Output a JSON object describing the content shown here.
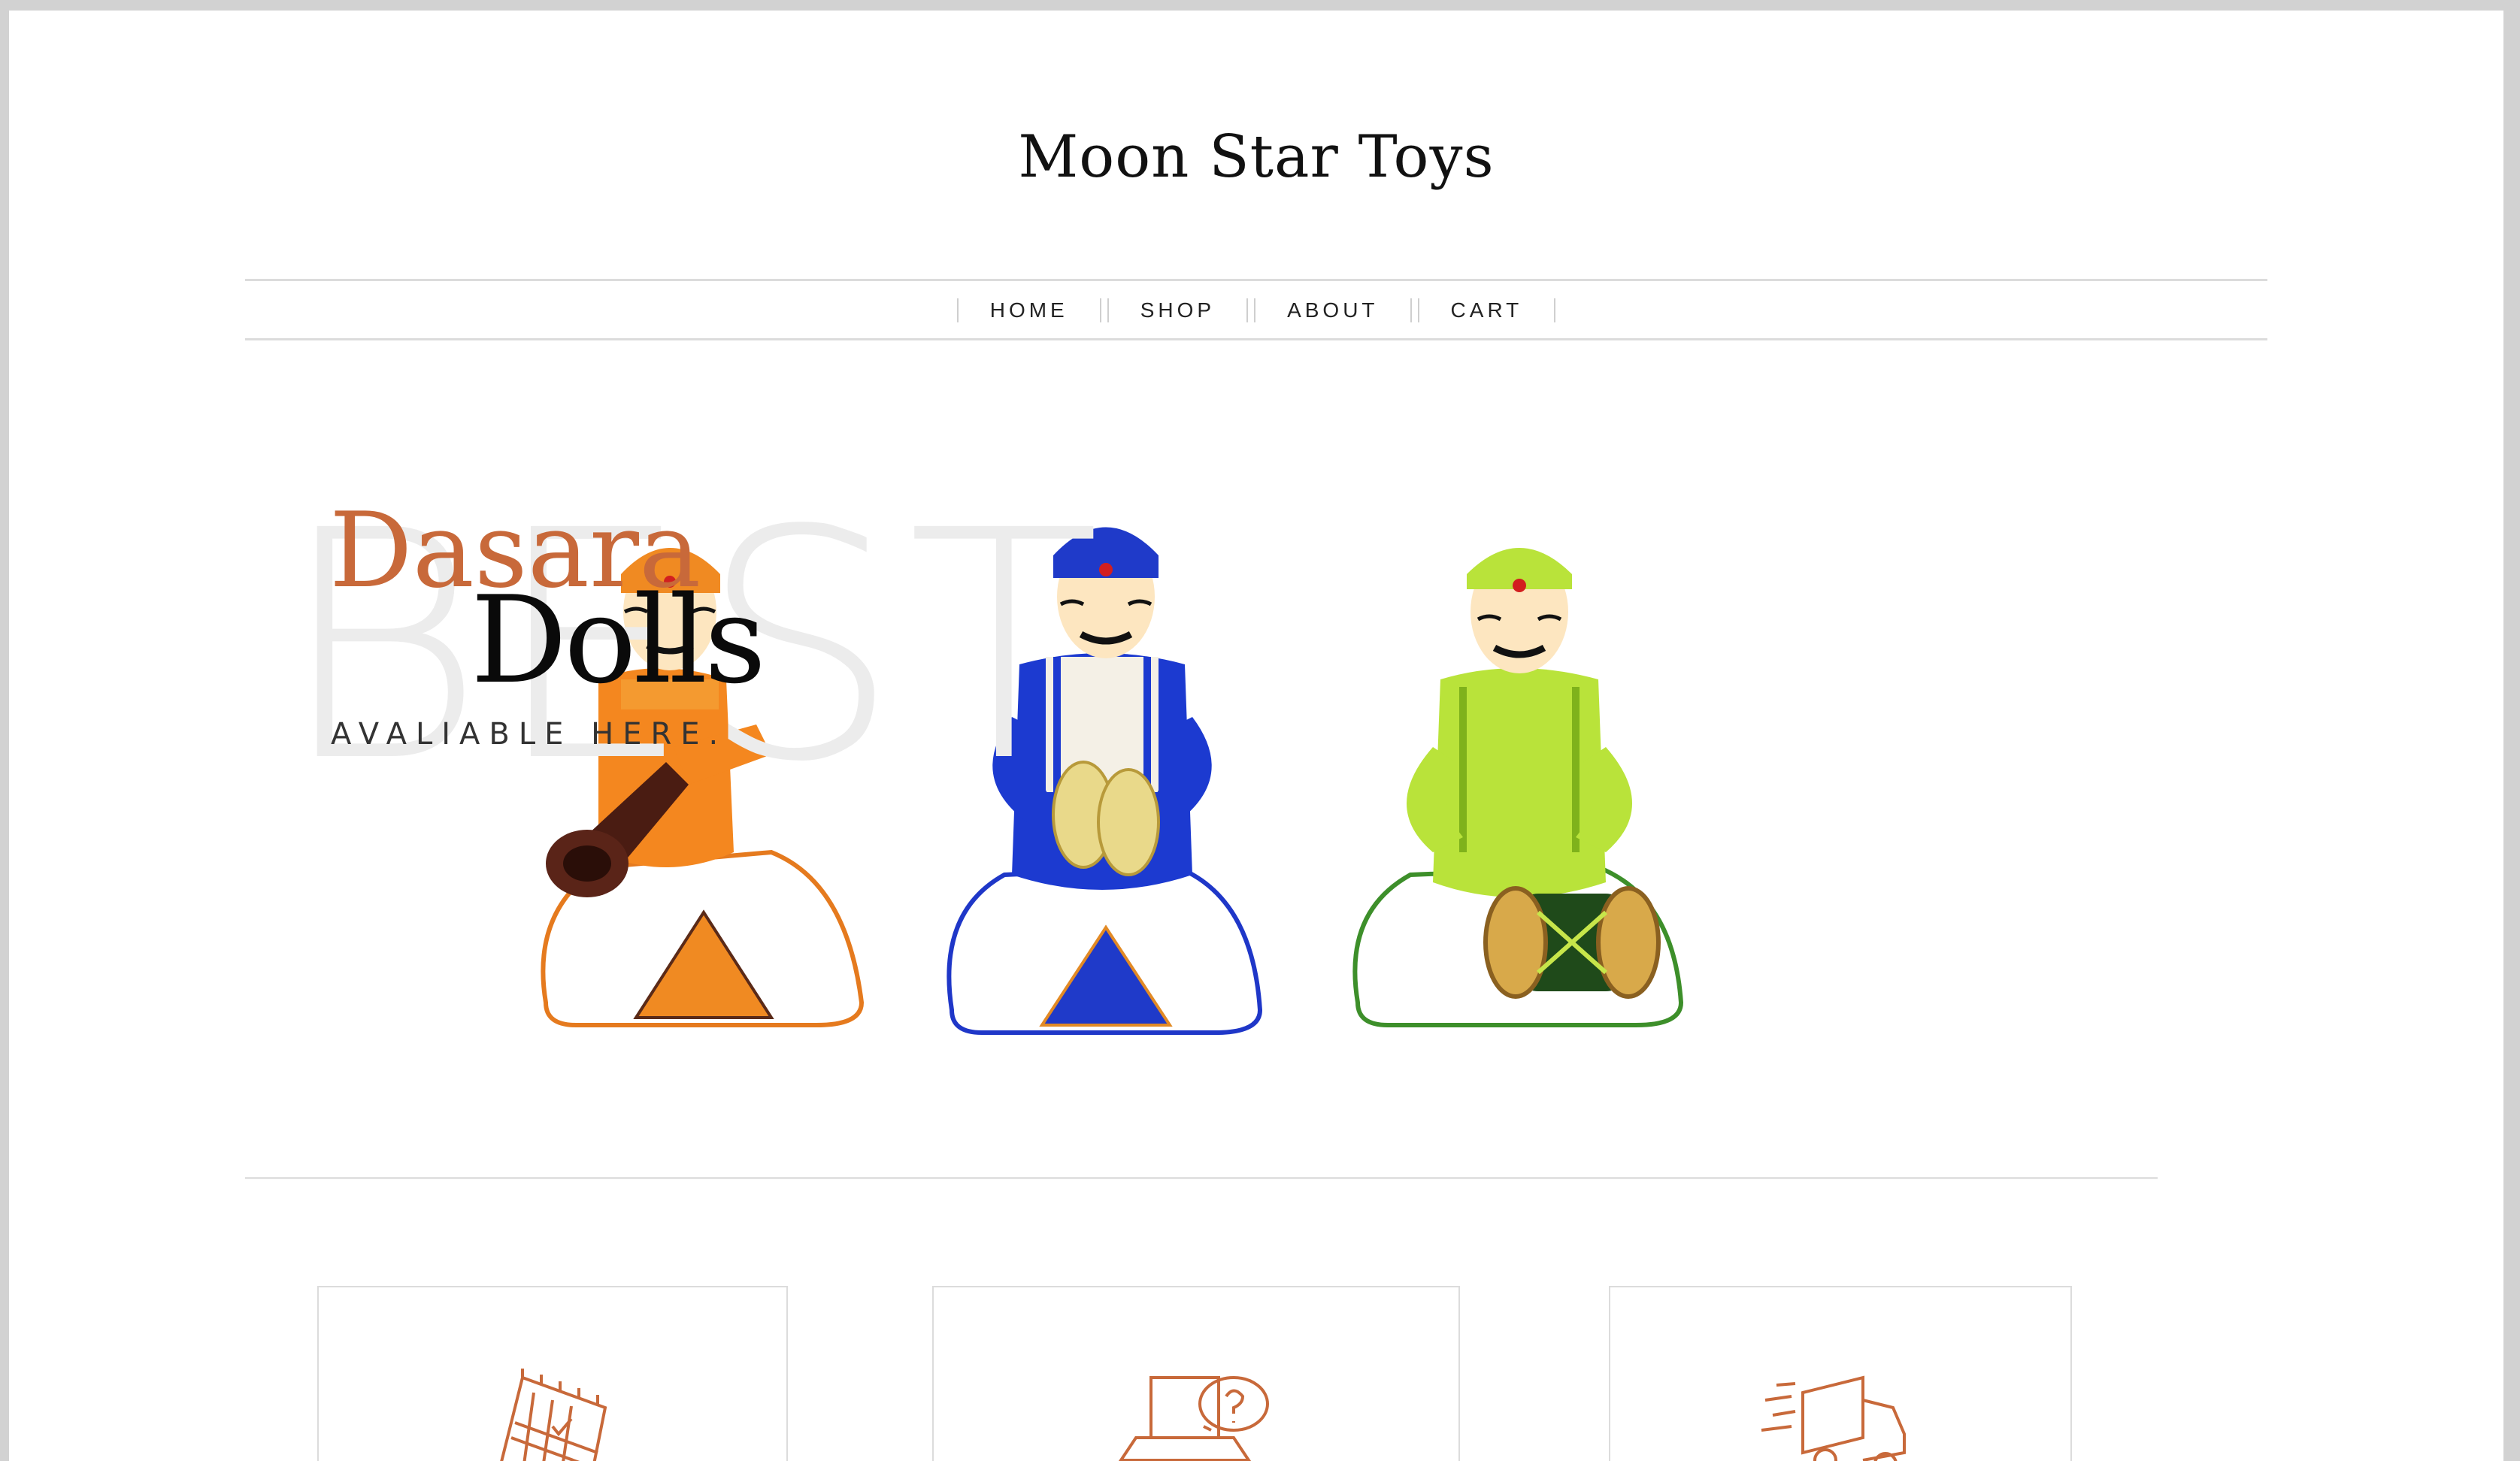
{
  "site": {
    "title": "Moon Star Toys"
  },
  "nav": {
    "items": [
      "HOME",
      "SHOP",
      "ABOUT",
      "CART"
    ]
  },
  "hero": {
    "background_word": "BEST",
    "line1": "Dasara",
    "line2": "Dolls",
    "subtitle": "AVALIABLE HERE."
  },
  "features": [
    {
      "icon": "calendar-icon"
    },
    {
      "icon": "laptop-support-icon"
    },
    {
      "icon": "delivery-truck-icon"
    }
  ],
  "colors": {
    "accent": "#c8693a",
    "rule": "#dcdcdc",
    "frame": "#d2d2d2"
  }
}
